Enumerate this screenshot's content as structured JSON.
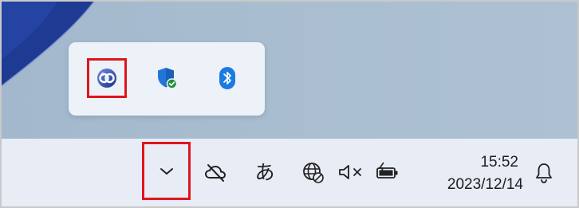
{
  "screen": {
    "colors": {
      "desktop_background": "#a9bdd0",
      "wallpaper_accent": "#1f3a92",
      "flyout_background": "#edf2f8",
      "taskbar_background": "#e7ecf5",
      "highlight": "#e0141e",
      "shield_blue": "#2376d8",
      "check_green": "#1b8f3a",
      "bluetooth_blue": "#1a7be0"
    }
  },
  "overflow_flyout": {
    "icons": [
      {
        "name": "remote-connection-icon",
        "highlighted": true
      },
      {
        "name": "windows-security-shield-icon",
        "highlighted": false
      },
      {
        "name": "bluetooth-icon",
        "highlighted": false
      }
    ]
  },
  "taskbar": {
    "show_hidden_icons": {
      "icon": "chevron-up-icon",
      "highlighted": true
    },
    "tray": {
      "onedrive_icon": "cloud-offline-icon",
      "ime_label": "あ",
      "network_icon": "globe-no-internet-icon",
      "volume_icon": "speaker-muted-icon",
      "battery_icon": "battery-charging-icon"
    },
    "clock": {
      "time": "15:52",
      "date": "2023/12/14"
    },
    "notifications_icon": "bell-icon"
  }
}
